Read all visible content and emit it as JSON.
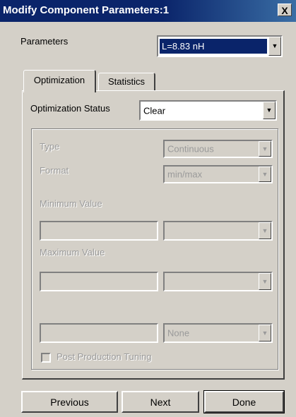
{
  "window": {
    "title": "Modify Component Parameters:1",
    "close_symbol": "X"
  },
  "parameters": {
    "label": "Parameters",
    "selected": "L=8.83 nH"
  },
  "tabs": [
    {
      "label": "Optimization",
      "active": true
    },
    {
      "label": "Statistics",
      "active": false
    }
  ],
  "optimization": {
    "status_label": "Optimization Status",
    "status_value": "Clear",
    "type_label": "Type",
    "type_value": "Continuous",
    "format_label": "Format",
    "format_value": "min/max",
    "min_label": "Minimum Value",
    "max_label": "Maximum Value",
    "extra_select_value": "None",
    "post_production_label": "Post Production Tuning"
  },
  "buttons": {
    "previous": "Previous",
    "next": "Next",
    "done": "Done"
  },
  "icons": {
    "dropdown_arrow": "▼"
  }
}
